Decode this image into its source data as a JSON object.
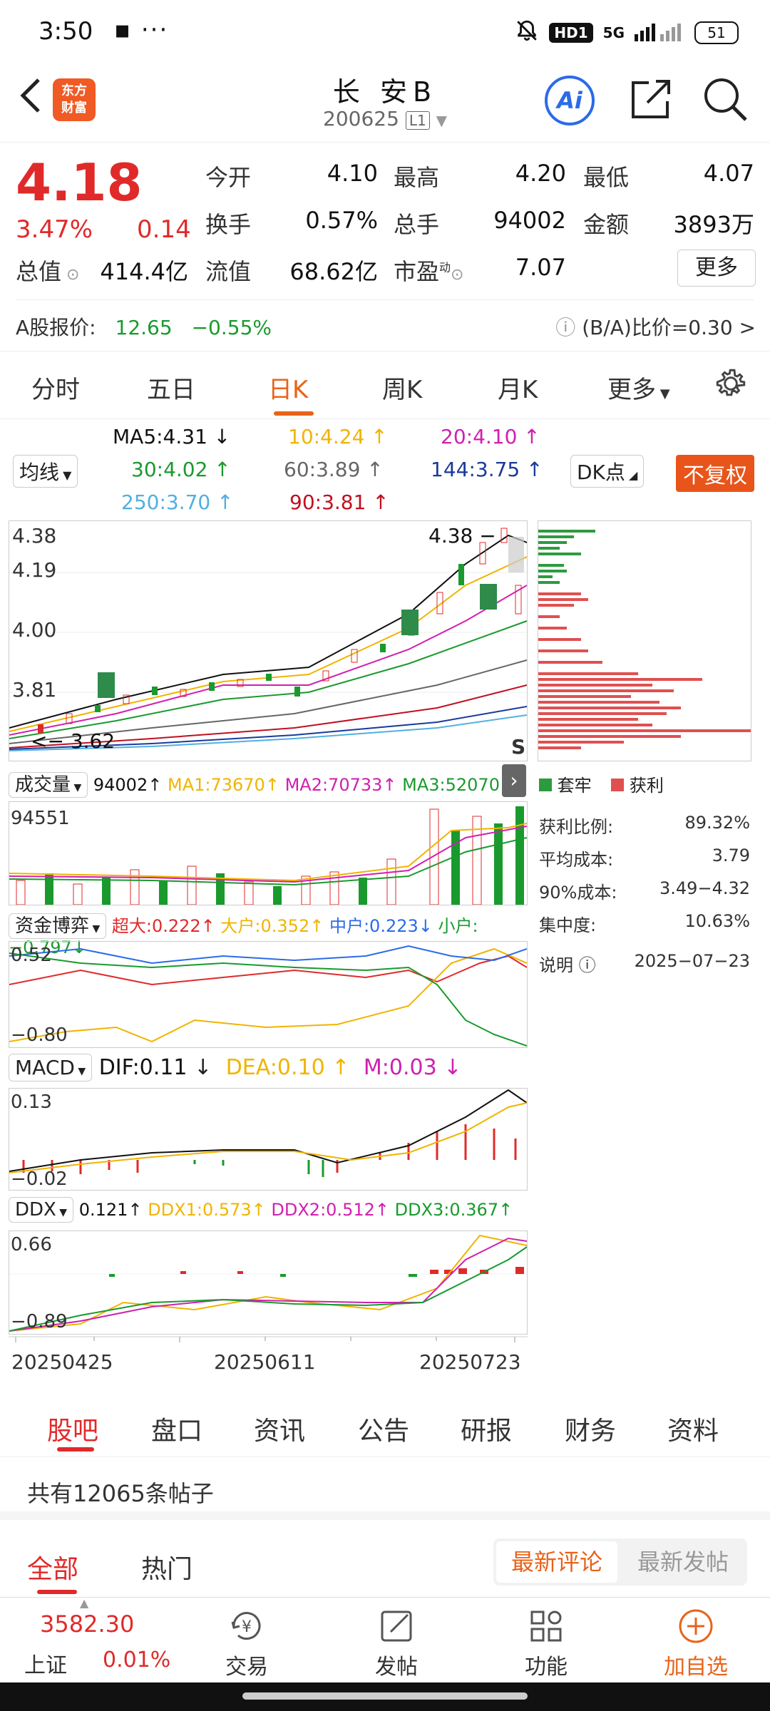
{
  "status_bar": {
    "time": "3:50",
    "network": "5G",
    "hd": "HD1",
    "battery": "51"
  },
  "header": {
    "logo_text": "东方\n财富",
    "stock_name": "长 安B",
    "stock_code": "200625",
    "level": "L1",
    "ai_label": "Ai"
  },
  "quote": {
    "price": "4.18",
    "change_pct": "3.47%",
    "change": "0.14",
    "open_label": "今开",
    "open": "4.10",
    "high_label": "最高",
    "high": "4.20",
    "low_label": "最低",
    "low": "4.07",
    "turnover_label": "换手",
    "turnover": "0.57%",
    "volume_label": "总手",
    "volume": "94002",
    "amount_label": "金额",
    "amount": "3893万",
    "mktcap_label": "总值",
    "mktcap": "414.4亿",
    "float_label": "流值",
    "float_cap": "68.62亿",
    "pe_label": "市盈",
    "pe_sup": "动",
    "pe": "7.07",
    "more_label": "更多"
  },
  "ashare": {
    "label": "A股报价:",
    "price": "12.65",
    "pct": "−0.55%",
    "ratio_label": "(B/A)比价=0.30 >"
  },
  "tabs": [
    {
      "label": "分时"
    },
    {
      "label": "五日"
    },
    {
      "label": "日K"
    },
    {
      "label": "周K"
    },
    {
      "label": "月K"
    },
    {
      "label": "更多"
    }
  ],
  "ma_legend": {
    "selector": "均线",
    "ma5": "MA5:4.31",
    "ma10": "10:4.24",
    "ma20": "20:4.10",
    "ma30": "30:4.02",
    "ma60": "60:3.89",
    "ma144": "144:3.75",
    "ma250": "250:3.70",
    "ma90": "90:3.81",
    "dk": "DK点",
    "fq": "不复权"
  },
  "kline_axis": {
    "y_top": "4.38",
    "y2": "4.19",
    "y3": "4.00",
    "y4": "3.81",
    "y_low_label": "3.62",
    "high_marker": "4.38",
    "s_marker": "S"
  },
  "chip_legend": {
    "trapped": "套牢",
    "profit": "获利"
  },
  "chip_stats": [
    {
      "label": "获利比例:",
      "value": "89.32%"
    },
    {
      "label": "平均成本:",
      "value": "3.79"
    },
    {
      "label": "90%成本:",
      "value": "3.49−4.32"
    },
    {
      "label": "集中度:",
      "value": "10.63%"
    }
  ],
  "chip_note": {
    "label": "说明",
    "date": "2025−07−23"
  },
  "volume_panel": {
    "selector": "成交量",
    "vol": "94002",
    "ma1": "MA1:73670",
    "ma2": "MA2:70733",
    "ma3": "MA3:52070",
    "y_top": "94551"
  },
  "fund_panel": {
    "selector": "资金博弈",
    "super": "超大:0.222",
    "big": "大户:0.352",
    "mid": "中户:0.223",
    "small": "小户:−0.797",
    "y_top": "0.52",
    "y_bot": "−0.80"
  },
  "macd_panel": {
    "selector": "MACD",
    "dif": "DIF:0.11",
    "dea": "DEA:0.10",
    "m": "M:0.03",
    "y_top": "0.13",
    "y_bot": "−0.02"
  },
  "ddx_panel": {
    "selector": "DDX",
    "ddx": "0.121",
    "ddx1": "DDX1:0.573",
    "ddx2": "DDX2:0.512",
    "ddx3": "DDX3:0.367",
    "y_top": "0.66",
    "y_bot": "−0.89"
  },
  "x_axis": {
    "d1": "20250425",
    "d2": "20250611",
    "d3": "20250723"
  },
  "bottom_tabs": [
    {
      "label": "股吧"
    },
    {
      "label": "盘口"
    },
    {
      "label": "资讯"
    },
    {
      "label": "公告"
    },
    {
      "label": "研报"
    },
    {
      "label": "财务"
    },
    {
      "label": "资料"
    }
  ],
  "posts": {
    "count_text": "共有12065条帖子",
    "all": "全部",
    "hot": "热门",
    "latest_comment": "最新评论",
    "latest_post": "最新发帖"
  },
  "footer": {
    "index_value": "3582.30",
    "index_name": "上证",
    "index_pct": "0.01%",
    "items": [
      {
        "label": "交易"
      },
      {
        "label": "发帖"
      },
      {
        "label": "功能"
      },
      {
        "label": "加自选"
      }
    ]
  },
  "colors": {
    "up": "#e02a2a",
    "down": "#1a9a2e",
    "accent": "#e8631a",
    "ma5": "#111111",
    "ma10": "#f0b400",
    "ma20": "#d020b0",
    "ma30": "#1a9a2e",
    "ma60": "#666666",
    "ma144": "#1a3a9a",
    "ma250": "#50b0e0",
    "ma90": "#c01020"
  }
}
